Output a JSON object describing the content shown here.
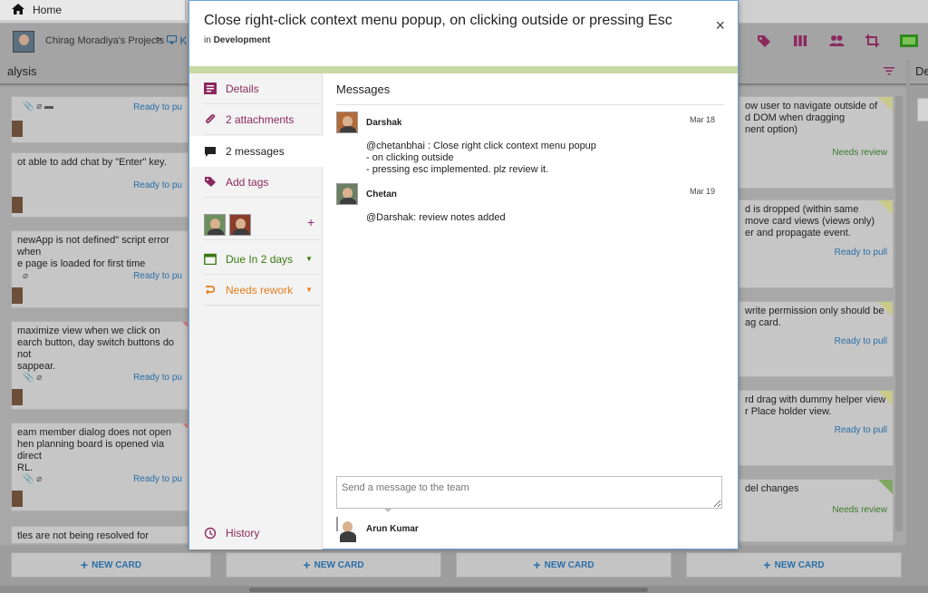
{
  "topbar": {
    "home_label": "Home"
  },
  "board": {
    "project_name": "Chirag Moradiya's Projects",
    "breadcrumb_sep": ">",
    "crumb_partial": "K",
    "columns": [
      {
        "title": "alysis"
      },
      {
        "title": "De"
      }
    ],
    "new_card_label": "NEW CARD",
    "left_cards": [
      {
        "text": "",
        "status": "Ready to pu"
      },
      {
        "text": "ot able to add chat by \"Enter\" key.",
        "status": "Ready to pu"
      },
      {
        "text": "newApp is not defined\" script error when\ne page is loaded for first time",
        "status": "Ready to pu"
      },
      {
        "text": " maximize view when we click on\nearch button, day switch buttons do not\nsappear.",
        "status": "Ready to pu"
      },
      {
        "text": "eam member dialog does not open\nhen planning board is opened via direct\nRL.",
        "status": "Ready to pu"
      },
      {
        "text": "tles are not being resolved for internal",
        "status": ""
      }
    ],
    "right_cards": [
      {
        "text": "ow user to navigate outside of\nd DOM when dragging\nnent option)",
        "status": "Needs review"
      },
      {
        "text": "d is dropped (within same\nmove card views (views only)\ner and propagate event.",
        "status": "Ready to pull"
      },
      {
        "text": " write permission only should be\nag card.",
        "status": "Ready to pull"
      },
      {
        "text": "rd drag with dummy helper view\nr Place holder view.",
        "status": "Ready to pull"
      },
      {
        "text": "del changes",
        "status": "Needs review"
      }
    ]
  },
  "modal": {
    "title": "Close right-click context menu popup, on clicking outside or pressing Esc",
    "in_label": "in",
    "list_name": "Development",
    "close_glyph": "×",
    "side": {
      "details": "Details",
      "attachments": "2 attachments",
      "messages": "2 messages",
      "tags": "Add tags",
      "add_member_glyph": "+",
      "due": "Due In 2 days",
      "rework": "Needs rework",
      "history": "History"
    },
    "messages_title": "Messages",
    "messages": [
      {
        "author": "Darshak",
        "date": "Mar 18",
        "body": "@chetanbhai : Close right click context menu popup\n        - on clicking outside\n        - pressing esc implemented. plz review it."
      },
      {
        "author": "Chetan",
        "date": "Mar 19",
        "body": "@Darshak: review notes added"
      }
    ],
    "input_placeholder": "Send a message to the team",
    "composer_name": "Arun Kumar"
  },
  "colors": {
    "accent_purple": "#8c2a5f",
    "accent_green_bar": "#c9d9a3",
    "link_blue": "#2a6ea8",
    "due_green": "#3a7a12",
    "rework_orange": "#e67d1c"
  },
  "icons": [
    "home-icon",
    "monitor-icon",
    "tag-icon",
    "columns-icon",
    "users-icon",
    "crop-icon",
    "fullscreen-icon",
    "filter-icon",
    "details-icon",
    "paperclip-icon",
    "speech-bubble-icon",
    "calendar-icon",
    "rework-icon",
    "history-icon"
  ]
}
